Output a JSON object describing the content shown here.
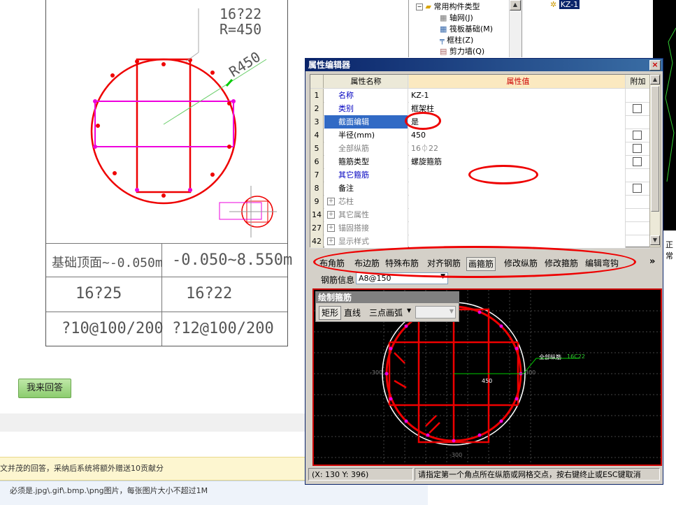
{
  "drawing": {
    "label_top": "16?22",
    "label_r": "R=450",
    "label_r450": "R450",
    "table": {
      "row1_left": "基础顶面~-0.050m",
      "row1_right": "-0.050~8.550m",
      "row2_left": "16?25",
      "row2_right": "16?22",
      "row3_left": "?10@100/200",
      "row3_right": "?12@100/200"
    }
  },
  "answer_button": "我来回答",
  "notice_text": "文并茂的回答，采纳后系统将额外赠送10贡献分",
  "hint_text": "必须是.jpg\\.gif\\.bmp.\\png图片，每张图片大小不超过1M",
  "tree": {
    "root": "常用构件类型",
    "items": [
      "轴网(J)",
      "筏板基础(M)",
      "框柱(Z)",
      "剪力墙(Q)"
    ],
    "right_item": "KZ-1"
  },
  "black_strip_text": "正常",
  "prop_editor": {
    "title": "属性编辑器",
    "close": "×",
    "headers": {
      "name": "属性名称",
      "value": "属性值",
      "add": "附加"
    },
    "rows": [
      {
        "num": "1",
        "name": "名称",
        "value": "KZ-1",
        "check": false,
        "expand": false,
        "style": "blue"
      },
      {
        "num": "2",
        "name": "类别",
        "value": "框架柱",
        "check": true,
        "expand": false,
        "style": "blue"
      },
      {
        "num": "3",
        "name": "截面编辑",
        "value": "是",
        "check": false,
        "expand": false,
        "style": "selected"
      },
      {
        "num": "4",
        "name": "半径(mm)",
        "value": "450",
        "check": true,
        "expand": false,
        "style": "black"
      },
      {
        "num": "5",
        "name": "全部纵筋",
        "value": "16⏀22",
        "check": true,
        "expand": false,
        "style": "gray"
      },
      {
        "num": "6",
        "name": "箍筋类型",
        "value": "螺旋箍筋",
        "check": true,
        "expand": false,
        "style": "black"
      },
      {
        "num": "7",
        "name": "其它箍筋",
        "value": "",
        "check": false,
        "expand": false,
        "style": "blue"
      },
      {
        "num": "8",
        "name": "备注",
        "value": "",
        "check": true,
        "expand": false,
        "style": "black"
      },
      {
        "num": "9",
        "name": "芯柱",
        "value": "",
        "check": false,
        "expand": true,
        "style": "gray"
      },
      {
        "num": "14",
        "name": "其它属性",
        "value": "",
        "check": false,
        "expand": true,
        "style": "gray"
      },
      {
        "num": "27",
        "name": "锚固搭接",
        "value": "",
        "check": false,
        "expand": true,
        "style": "gray"
      },
      {
        "num": "42",
        "name": "显示样式",
        "value": "",
        "check": false,
        "expand": true,
        "style": "gray"
      }
    ],
    "toolbar": [
      "布角筋",
      "布边筋",
      "特殊布筋",
      "对齐钢筋",
      "画箍筋",
      "修改纵筋",
      "修改箍筋",
      "编辑弯钩"
    ],
    "toolbar_more": "»",
    "rebar_label": "钢筋信息",
    "rebar_value": "A8@150",
    "draw_panel": {
      "title": "绘制箍筋",
      "rect": "矩形",
      "line": "直线",
      "arc": "三点画弧"
    },
    "canvas": {
      "label_all": "全部纵筋",
      "label_all_val": "16C22",
      "dim_450": "450",
      "dim_left": "-300",
      "dim_right": "300",
      "dim_bottom": "-300"
    },
    "status": {
      "coords": "(X: 130 Y: 396)",
      "message": "请指定第一个角点所在纵筋或网格交点，按右键终止或ESC键取消"
    }
  }
}
